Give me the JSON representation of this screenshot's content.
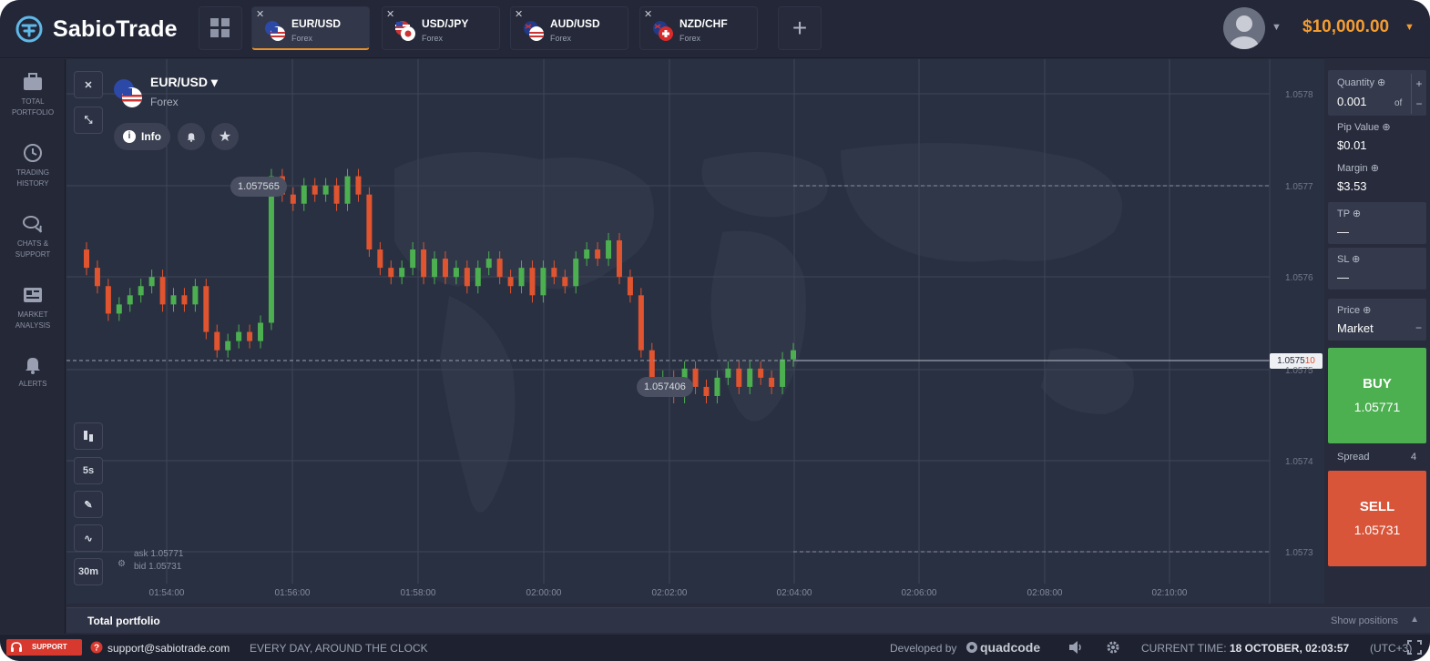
{
  "brand": {
    "name": "SabioTrade"
  },
  "tabs": [
    {
      "name": "EUR/USD",
      "type": "Forex",
      "active": true
    },
    {
      "name": "USD/JPY",
      "type": "Forex",
      "active": false
    },
    {
      "name": "AUD/USD",
      "type": "Forex",
      "active": false
    },
    {
      "name": "NZD/CHF",
      "type": "Forex",
      "active": false
    }
  ],
  "account": {
    "balance": "$10,000.00"
  },
  "sidebar": {
    "items": [
      {
        "label": "TOTAL PORTFOLIO",
        "icon": "briefcase-icon"
      },
      {
        "label": "TRADING HISTORY",
        "icon": "history-icon"
      },
      {
        "label": "CHATS & SUPPORT",
        "icon": "chat-icon"
      },
      {
        "label": "MARKET ANALYSIS",
        "icon": "news-icon"
      },
      {
        "label": "ALERTS",
        "icon": "bell-icon"
      }
    ]
  },
  "asset": {
    "name": "EUR/USD",
    "type": "Forex",
    "info_label": "Info"
  },
  "chart_tools": {
    "timeframe": "5s",
    "period": "30m"
  },
  "chart": {
    "high_label": "1.057565",
    "low_label": "1.057406",
    "current_price_main": "1.0575",
    "current_price_tail": "10",
    "ask_label": "ask 1.05771",
    "bid_label": "bid 1.05731",
    "y_ticks": [
      "1.0578",
      "1.0577",
      "1.0576",
      "1.0575",
      "1.0574",
      "1.0573"
    ],
    "x_ticks": [
      "01:54:00",
      "01:56:00",
      "01:58:00",
      "02:00:00",
      "02:02:00",
      "02:04:00",
      "02:06:00",
      "02:08:00",
      "02:10:00"
    ]
  },
  "chart_data": {
    "type": "candlestick",
    "x_range": [
      "01:54:00",
      "02:10:00"
    ],
    "y_range": [
      1.0573,
      1.0578
    ],
    "close_series": [
      1.05761,
      1.05759,
      1.05756,
      1.05757,
      1.05758,
      1.05759,
      1.0576,
      1.05757,
      1.05758,
      1.05757,
      1.05759,
      1.05754,
      1.05752,
      1.05753,
      1.05754,
      1.05753,
      1.05755,
      1.05771,
      1.05769,
      1.05768,
      1.0577,
      1.05769,
      1.0577,
      1.05768,
      1.05771,
      1.05769,
      1.05763,
      1.05761,
      1.0576,
      1.05761,
      1.05763,
      1.0576,
      1.05762,
      1.0576,
      1.05761,
      1.05759,
      1.05761,
      1.05762,
      1.0576,
      1.05759,
      1.05761,
      1.05758,
      1.05761,
      1.0576,
      1.05759,
      1.05762,
      1.05763,
      1.05762,
      1.05764,
      1.0576,
      1.05758,
      1.05752,
      1.05748,
      1.05749,
      1.05747,
      1.0575,
      1.05748,
      1.05747,
      1.05749,
      1.0575,
      1.05748,
      1.0575,
      1.05749,
      1.05748,
      1.05751,
      1.05752
    ],
    "high": "1.057565",
    "low": "1.057406",
    "last": "1.057510"
  },
  "trade": {
    "quantity_label": "Quantity",
    "quantity_value": "0.001",
    "quantity_unit": "of",
    "pip_label": "Pip Value",
    "pip_value": "$0.01",
    "margin_label": "Margin",
    "margin_value": "$3.53",
    "tp_label": "TP",
    "tp_value": "—",
    "sl_label": "SL",
    "sl_value": "—",
    "price_label": "Price",
    "price_value": "Market",
    "buy_label": "BUY",
    "buy_price": "1.05771",
    "spread_label": "Spread",
    "spread_value": "4",
    "sell_label": "SELL",
    "sell_price": "1.05731"
  },
  "portfolio": {
    "title": "Total portfolio",
    "show_positions": "Show positions"
  },
  "footer": {
    "support_label": "SUPPORT",
    "email": "support@sabiotrade.com",
    "hours": "EVERY DAY, AROUND THE CLOCK",
    "developed_by": "Developed by",
    "developer": "quadcode",
    "time_label": "CURRENT TIME:",
    "time_value": "18 OCTOBER, 02:03:57",
    "timezone": "(UTC+3)"
  },
  "colors": {
    "accent": "#f39c32",
    "buy": "#4caf50",
    "sell": "#d8553a",
    "candle_up": "#4caf50",
    "candle_down": "#e0542f"
  }
}
